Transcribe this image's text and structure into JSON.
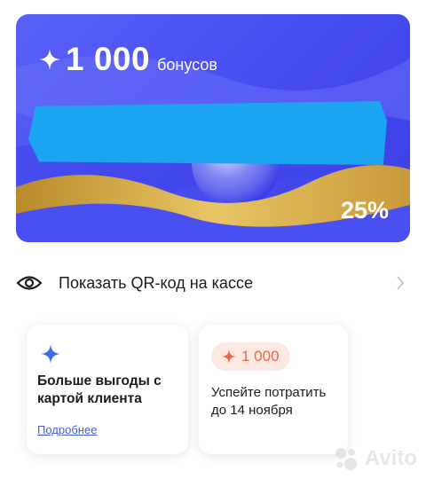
{
  "card": {
    "bonus_amount": "1 000",
    "bonus_unit": "бонусов",
    "discount": "25%"
  },
  "qr": {
    "label": "Показать QR-код на кассе"
  },
  "tiles": {
    "benefits": {
      "title": "Больше выгоды с картой клиента",
      "link": "Подробнее"
    },
    "expiry": {
      "badge_amount": "1 000",
      "text": "Успейте потратить до 14 ноября"
    }
  },
  "watermark": "Avito",
  "colors": {
    "card_blue": "#4a4ff2",
    "redaction": "#1ba4f0",
    "gold": "#d9b14a",
    "link_blue": "#3f5fd8",
    "badge_orange": "#ec6a4a",
    "badge_bg": "#fde9e3",
    "star_blue": "#3a6be8"
  },
  "icons": [
    "sparkle-icon",
    "eye-icon",
    "chevron-right-icon",
    "sparkle-blue-icon",
    "sparkle-orange-icon",
    "avito-logo-icon"
  ]
}
